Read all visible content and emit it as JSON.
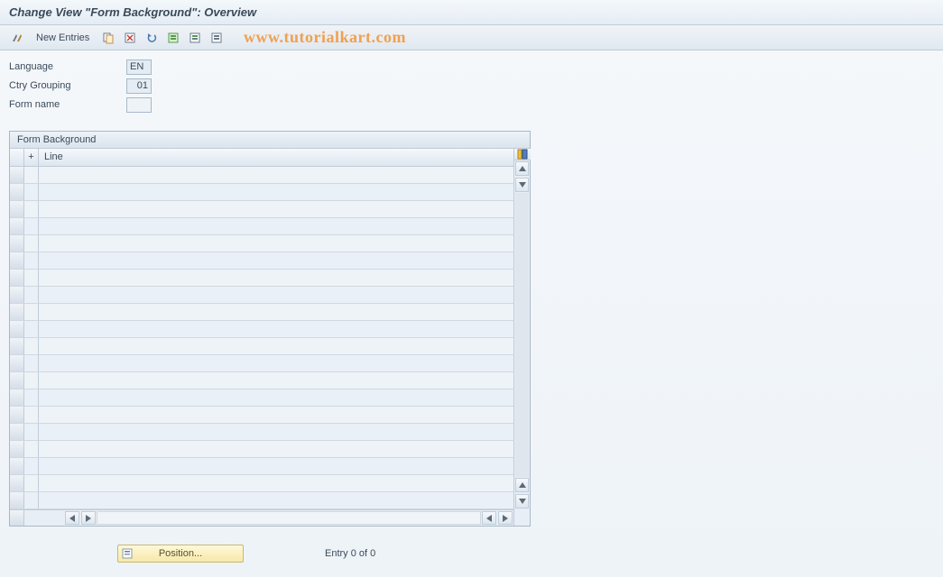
{
  "header": {
    "title": "Change View \"Form Background\": Overview"
  },
  "toolbar": {
    "new_entries_label": "New Entries",
    "watermark": "www.tutorialkart.com"
  },
  "fields": {
    "language": {
      "label": "Language",
      "value": "EN"
    },
    "ctry_grouping": {
      "label": "Ctry Grouping",
      "value": "01"
    },
    "form_name": {
      "label": "Form name",
      "value": ""
    }
  },
  "table": {
    "caption": "Form Background",
    "columns": {
      "plus": "+",
      "line": "Line"
    },
    "rows": [
      "",
      "",
      "",
      "",
      "",
      "",
      "",
      "",
      "",
      "",
      "",
      "",
      "",
      "",
      "",
      "",
      "",
      "",
      "",
      ""
    ]
  },
  "footer": {
    "position_label": "Position...",
    "entry_text": "Entry 0 of 0"
  }
}
